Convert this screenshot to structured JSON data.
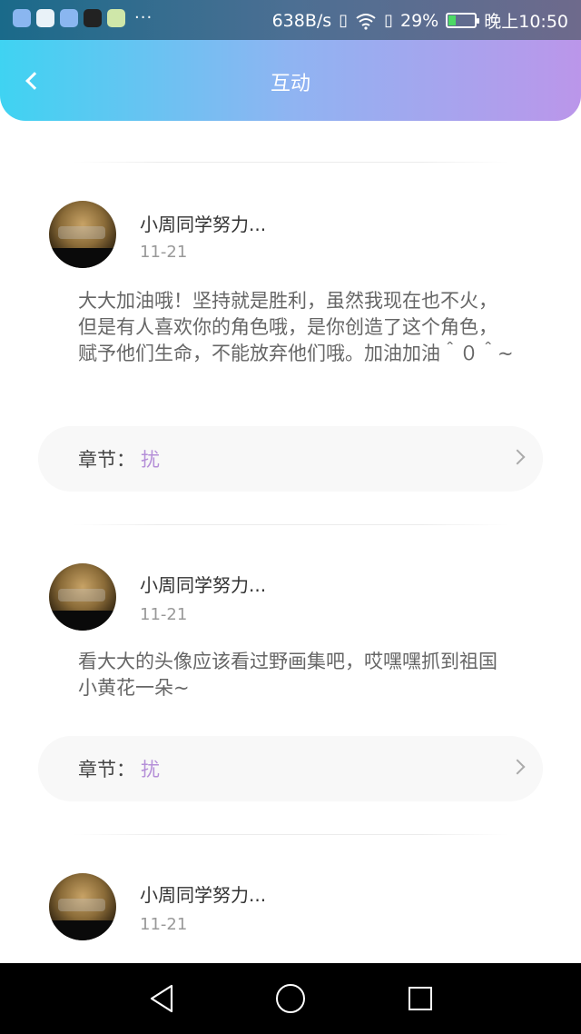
{
  "status_bar": {
    "speed": "638B/s",
    "battery_percent": "29%",
    "battery_level": 0.29,
    "time": "晚上10:50",
    "dots": "···"
  },
  "header": {
    "title": "互动"
  },
  "posts": [
    {
      "name": "小周同学努力...",
      "date": "11-21",
      "text": "大大加油哦！坚持就是胜利，虽然我现在也不火，但是有人喜欢你的角色哦，是你创造了这个角色，赋予他们生命，不能放弃他们哦。加油加油＾０＾~",
      "chapter_label": "章节：",
      "chapter_value": "扰"
    },
    {
      "name": "小周同学努力...",
      "date": "11-21",
      "text": "看大大的头像应该看过野画集吧，哎嘿嘿抓到祖国小黄花一朵~",
      "chapter_label": "章节：",
      "chapter_value": "扰"
    },
    {
      "name": "小周同学努力...",
      "date": "11-21",
      "text": "",
      "chapter_label": "",
      "chapter_value": ""
    }
  ]
}
